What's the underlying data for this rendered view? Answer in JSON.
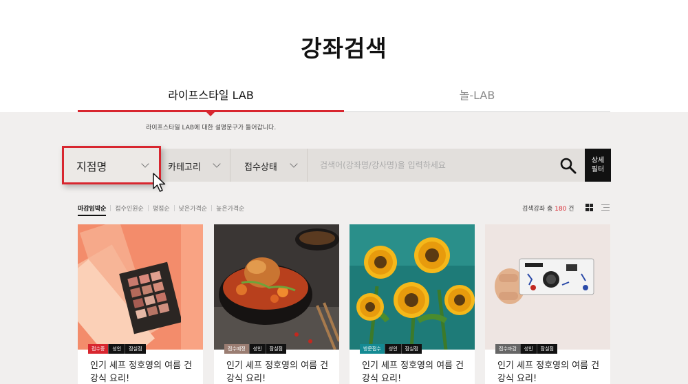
{
  "page_title": "강좌검색",
  "tabs": [
    {
      "label": "라이프스타일 LAB",
      "active": true
    },
    {
      "label": "놀-LAB",
      "active": false
    }
  ],
  "tab_description": "라이프스타일 LAB에 대한 설명문구가 들어갑니다.",
  "filters": {
    "branch": "지점명",
    "category": "카테고리",
    "status": "접수상태",
    "search_placeholder": "검색어(강좌명/강사명)을 입력하세요",
    "detail_filter": [
      "상세",
      "필터"
    ]
  },
  "sort": {
    "items": [
      "마감임박순",
      "접수인원순",
      "평점순",
      "낮은가격순",
      "높은가격순"
    ],
    "active_index": 0
  },
  "result_count": {
    "prefix": "검색강좌 총 ",
    "number": "180",
    "suffix": " 건"
  },
  "colors": {
    "accent": "#d8262f",
    "background_lower": "#f1efee",
    "filter_bg": "#e2dfdc"
  },
  "cards": [
    {
      "status": "접수중",
      "status_color": "#d8262f",
      "age": "성인",
      "branch": "잠실점",
      "title": "인기 셰프 정호영의 여름 건강식 요리!"
    },
    {
      "status": "접수예정",
      "status_color": "#9a7d72",
      "age": "성인",
      "branch": "잠실점",
      "title": "인기 셰프 정호영의 여름 건강식 요리!"
    },
    {
      "status": "방문접수",
      "status_color": "#148a93",
      "age": "성인",
      "branch": "잠실점",
      "title": "인기 셰프 정호영의 여름 건강식 요리!"
    },
    {
      "status": "접수마감",
      "status_color": "#666666",
      "age": "성인",
      "branch": "잠실점",
      "title": "인기 셰프 정호영의 여름 건강식 요리!"
    }
  ]
}
